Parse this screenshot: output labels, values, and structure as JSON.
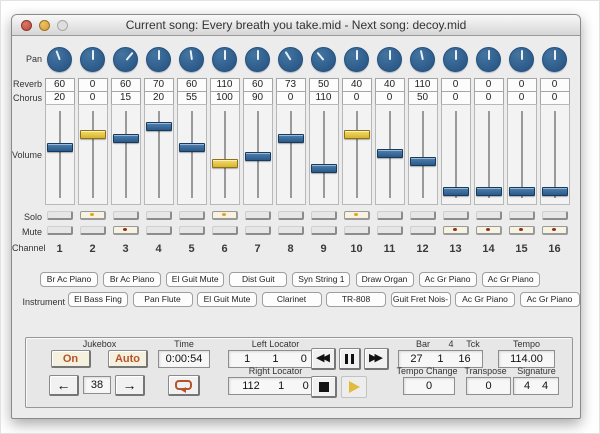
{
  "window": {
    "title": "Current song: Every breath you take.mid - Next song: decoy.mid"
  },
  "row_labels": {
    "pan": "Pan",
    "reverb": "Reverb",
    "chorus": "Chorus",
    "volume": "Volume",
    "solo": "Solo",
    "mute": "Mute",
    "channel": "Channel",
    "instrument": "Instrument"
  },
  "channels": [
    {
      "num": "1",
      "pan_deg": -20,
      "reverb": "60",
      "chorus": "20",
      "volume_pct_from_top": 42,
      "solo": false,
      "mute": false
    },
    {
      "num": "2",
      "pan_deg": 0,
      "reverb": "0",
      "chorus": "0",
      "volume_pct_from_top": 25,
      "solo": true,
      "mute": false
    },
    {
      "num": "3",
      "pan_deg": 40,
      "reverb": "60",
      "chorus": "15",
      "volume_pct_from_top": 31,
      "solo": false,
      "mute": true
    },
    {
      "num": "4",
      "pan_deg": 0,
      "reverb": "70",
      "chorus": "20",
      "volume_pct_from_top": 16,
      "solo": false,
      "mute": false
    },
    {
      "num": "5",
      "pan_deg": -8,
      "reverb": "60",
      "chorus": "55",
      "volume_pct_from_top": 42,
      "solo": false,
      "mute": false
    },
    {
      "num": "6",
      "pan_deg": 0,
      "reverb": "110",
      "chorus": "100",
      "volume_pct_from_top": 61,
      "solo": true,
      "mute": false
    },
    {
      "num": "7",
      "pan_deg": 0,
      "reverb": "60",
      "chorus": "90",
      "volume_pct_from_top": 53,
      "solo": false,
      "mute": false
    },
    {
      "num": "8",
      "pan_deg": -32,
      "reverb": "73",
      "chorus": "0",
      "volume_pct_from_top": 31,
      "solo": false,
      "mute": false
    },
    {
      "num": "9",
      "pan_deg": -40,
      "reverb": "50",
      "chorus": "110",
      "volume_pct_from_top": 67,
      "solo": false,
      "mute": false
    },
    {
      "num": "10",
      "pan_deg": 0,
      "reverb": "40",
      "chorus": "0",
      "volume_pct_from_top": 26,
      "solo": true,
      "mute": false
    },
    {
      "num": "11",
      "pan_deg": 0,
      "reverb": "40",
      "chorus": "0",
      "volume_pct_from_top": 49,
      "solo": false,
      "mute": false
    },
    {
      "num": "12",
      "pan_deg": -12,
      "reverb": "110",
      "chorus": "50",
      "volume_pct_from_top": 59,
      "solo": false,
      "mute": false
    },
    {
      "num": "13",
      "pan_deg": 0,
      "reverb": "0",
      "chorus": "0",
      "volume_pct_from_top": 95,
      "solo": false,
      "mute": true
    },
    {
      "num": "14",
      "pan_deg": 0,
      "reverb": "0",
      "chorus": "0",
      "volume_pct_from_top": 95,
      "solo": false,
      "mute": true
    },
    {
      "num": "15",
      "pan_deg": 0,
      "reverb": "0",
      "chorus": "0",
      "volume_pct_from_top": 95,
      "solo": false,
      "mute": true
    },
    {
      "num": "16",
      "pan_deg": 0,
      "reverb": "0",
      "chorus": "0",
      "volume_pct_from_top": 95,
      "solo": false,
      "mute": true
    }
  ],
  "instruments": {
    "top_row": [
      "Br Ac Piano",
      "Br Ac Piano",
      "El Guit Mute",
      "Dist Guit",
      "Syn String 1",
      "Draw Organ",
      "Ac Gr Piano",
      "Ac Gr Piano"
    ],
    "bottom_row": [
      "El Bass Fing",
      "Pan Flute",
      "El Guit Mute",
      "Clarinet",
      "TR-808",
      "Guit Fret Nois-",
      "Ac Gr Piano",
      "Ac Gr Piano"
    ]
  },
  "panel": {
    "jukebox": {
      "label": "Jukebox",
      "on": "On",
      "auto": "Auto",
      "song_number": "38"
    },
    "time": {
      "label": "Time",
      "value": "0:00:54"
    },
    "left_locator": {
      "label": "Left Locator",
      "values": [
        "1",
        "1",
        "0"
      ]
    },
    "right_locator": {
      "label": "Right Locator",
      "values": [
        "112",
        "1",
        "0"
      ]
    },
    "position": {
      "label_bar": "Bar",
      "label_beat": "4",
      "label_tick": "Tck",
      "values": [
        "27",
        "1",
        "16"
      ]
    },
    "tempo": {
      "label": "Tempo",
      "value": "114.00"
    },
    "tempo_change": {
      "label": "Tempo Change",
      "value": "0"
    },
    "transpose": {
      "label": "Transpose",
      "value": "0"
    },
    "signature": {
      "label": "Signature",
      "values": [
        "4",
        "4"
      ]
    }
  },
  "colors": {
    "knob_blue": "#336699",
    "thumb_blue": "#2e5f90",
    "thumb_yellow": "#e8cc4a",
    "solo_dot": "#dca616",
    "mute_dot": "#8e2e1d",
    "accent_orange": "#b5542a",
    "play_gold": "#e2bb3e",
    "window_bg": "#ececec"
  }
}
